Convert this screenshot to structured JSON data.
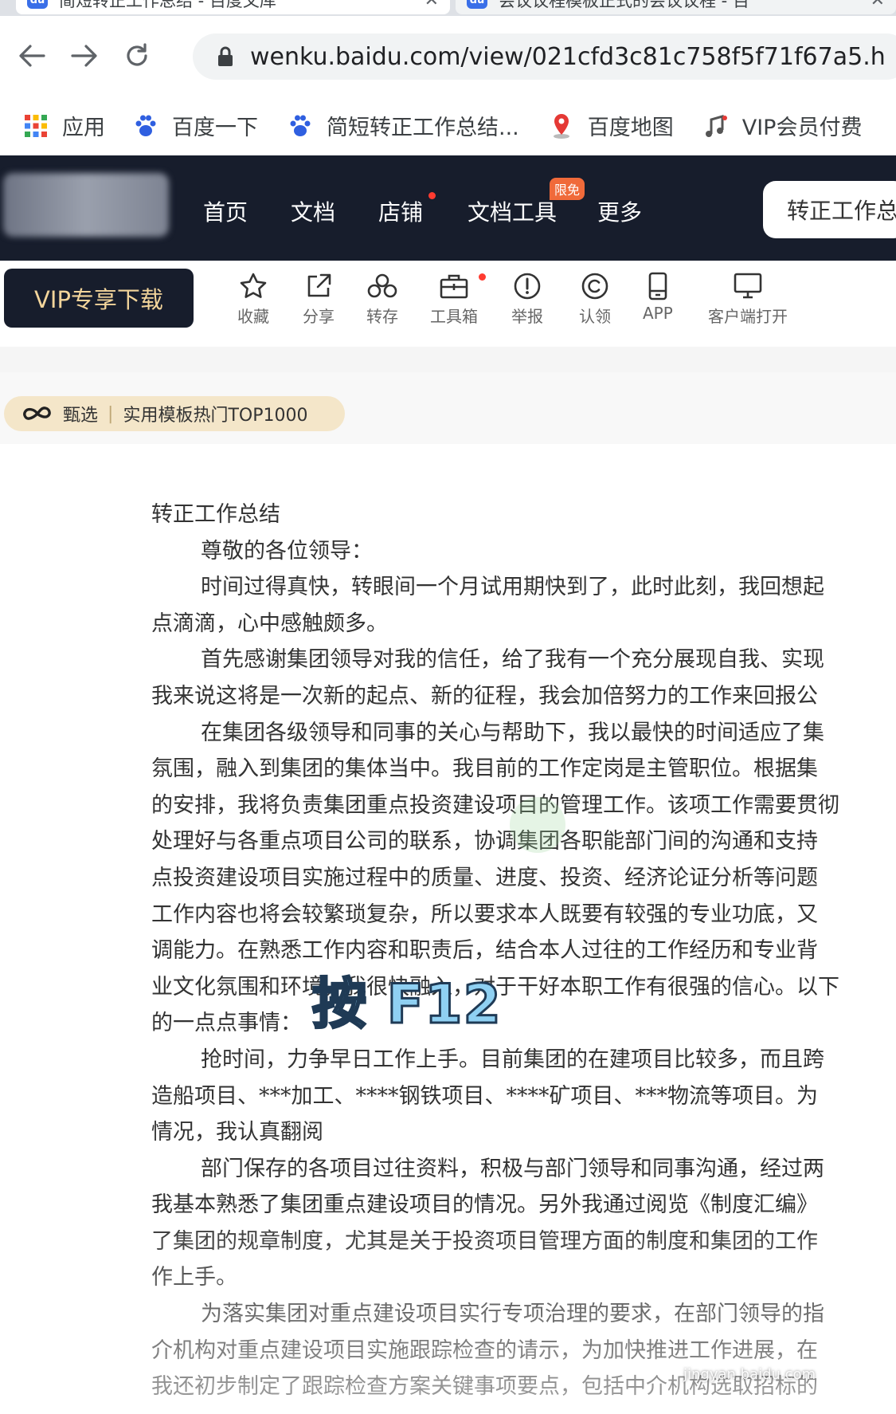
{
  "browser": {
    "tabs": [
      {
        "favicon": "du",
        "title": "简短转正工作总结 - 百度文库",
        "close": "✕"
      },
      {
        "favicon": "du",
        "title": "会议议程模板正式的会议议程 - 百",
        "close": "✕"
      }
    ],
    "url": "wenku.baidu.com/view/021cfd3c81c758f5f71f67a5.h",
    "bookmarks": [
      {
        "icon": "apps-grid-icon",
        "label": "应用"
      },
      {
        "icon": "baidu-paw-icon",
        "label": "百度一下"
      },
      {
        "icon": "baidu-paw-icon",
        "label": "简短转正工作总结..."
      },
      {
        "icon": "map-pin-icon",
        "label": "百度地图"
      },
      {
        "icon": "music-note-icon",
        "label": "VIP会员付费"
      }
    ]
  },
  "site": {
    "nav": [
      {
        "label": "首页",
        "dot": false
      },
      {
        "label": "文档",
        "dot": false
      },
      {
        "label": "店铺",
        "dot": true
      },
      {
        "label": "文档工具",
        "dot": false
      },
      {
        "label": "更多",
        "dot": false
      }
    ],
    "tools_badge": "限免",
    "search_value": "转正工作总",
    "vip_button": "VIP专享下载",
    "tools": [
      {
        "icon": "star-icon",
        "label": "收藏"
      },
      {
        "icon": "share-icon",
        "label": "分享"
      },
      {
        "icon": "save-icon",
        "label": "转存"
      },
      {
        "icon": "toolbox-icon",
        "label": "工具箱"
      },
      {
        "icon": "report-icon",
        "label": "举报"
      },
      {
        "icon": "copyright-icon",
        "label": "认领"
      },
      {
        "icon": "phone-icon",
        "label": "APP"
      },
      {
        "icon": "desktop-icon",
        "label": "客户端打开"
      }
    ],
    "select_tag": {
      "icon": "infinity-icon",
      "label": "甄选",
      "text": "实用模板热门TOP1000"
    }
  },
  "document": {
    "lines": [
      {
        "indent": false,
        "text": "转正工作总结"
      },
      {
        "indent": true,
        "text": "尊敬的各位领导："
      },
      {
        "indent": true,
        "text": "时间过得真快，转眼间一个月试用期快到了，此时此刻，我回想起"
      },
      {
        "indent": false,
        "text": "点滴滴，心中感触颇多。"
      },
      {
        "indent": true,
        "text": "首先感谢集团领导对我的信任，给了我有一个充分展现自我、实现"
      },
      {
        "indent": false,
        "text": "我来说这将是一次新的起点、新的征程，我会加倍努力的工作来回报公"
      },
      {
        "indent": true,
        "text": "在集团各级领导和同事的关心与帮助下，我以最快的时间适应了集"
      },
      {
        "indent": false,
        "text": "氛围，融入到集团的集体当中。我目前的工作定岗是主管职位。根据集"
      },
      {
        "indent": false,
        "text": "的安排，我将负责集团重点投资建设项目的管理工作。该项工作需要贯彻"
      },
      {
        "indent": false,
        "text": "处理好与各重点项目公司的联系，协调集团各职能部门间的沟通和支持"
      },
      {
        "indent": false,
        "text": "点投资建设项目实施过程中的质量、进度、投资、经济论证分析等问题"
      },
      {
        "indent": false,
        "text": "工作内容也将会较繁琐复杂，所以要求本人既要有较强的专业功底，又"
      },
      {
        "indent": false,
        "text": "调能力。在熟悉工作内容和职责后，结合本人过往的工作经历和专业背"
      },
      {
        "indent": false,
        "text": "业文化氛围和环境，我很快融入，对于干好本职工作有很强的信心。以下"
      },
      {
        "indent": false,
        "text": "的一点点事情："
      },
      {
        "indent": true,
        "text": "抢时间，力争早日工作上手。目前集团的在建项目比较多，而且跨"
      },
      {
        "indent": false,
        "text": "造船项目、***加工、****钢铁项目、****矿项目、***物流等项目。为"
      },
      {
        "indent": false,
        "text": "情况，我认真翻阅"
      },
      {
        "indent": true,
        "text": "部门保存的各项目过往资料，积极与部门领导和同事沟通，经过两"
      },
      {
        "indent": false,
        "text": "我基本熟悉了集团重点建设项目的情况。另外我通过阅览《制度汇编》"
      },
      {
        "indent": false,
        "text": "了集团的规章制度，尤其是关于投资项目管理方面的制度和集团的工作"
      },
      {
        "indent": false,
        "text": "作上手。"
      },
      {
        "indent": true,
        "text": "为落实集团对重点建设项目实行专项治理的要求，在部门领导的指"
      },
      {
        "indent": false,
        "text": "介机构对重点建设项目实施跟踪检查的请示，为加快推进工作进展，在"
      },
      {
        "indent": false,
        "text": "我还初步制定了跟踪检查方案关键事项要点，包括中介机构选取招标的"
      }
    ]
  },
  "overlay_caption": "按 F12",
  "watermark": "jingyan.baidu.com"
}
